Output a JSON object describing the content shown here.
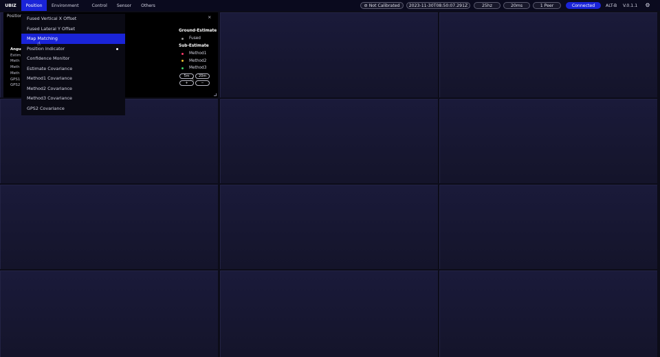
{
  "brand": "UBIZ",
  "menu": {
    "position": "Position",
    "environment": "Environment",
    "control": "Control",
    "sensor": "Sensor",
    "others": "Others"
  },
  "status": {
    "calibration": "Not Calibrated",
    "timestamp": "2023-11-30T08:50:07.291Z",
    "rate": "25hz",
    "latency": "20ms",
    "peers": "1 Peer",
    "connection": "Connected",
    "device": "ALT-B",
    "version": "V.0.1.1"
  },
  "panel": {
    "title": "Position",
    "close": "×",
    "left_labels": [
      "Angul",
      "Estim",
      "Meth",
      "Meth",
      "Meth",
      "GPS1",
      "GPS2"
    ]
  },
  "legend": {
    "ground_title": "Ground-Estimate",
    "ground_items": [
      "Fused"
    ],
    "sub_title": "Sub-Estimate",
    "sub_items": [
      "Method1",
      "Method2",
      "Method3"
    ],
    "colors": {
      "fused": "#9a9a9a",
      "method1": "#ff3b6b",
      "method2": "#f2c230",
      "method3": "#40d36a"
    }
  },
  "range_buttons": {
    "b5m": "5m",
    "b20m": "20m",
    "plus": "+",
    "minus": "−"
  },
  "dropdown": {
    "items": [
      "Fused Vertical X Offset",
      "Fused Lateral Y Offset",
      "Map Matching",
      "Position Indicator",
      "Confidence Monitor",
      "Estimate Covariance",
      "Method1 Covariance",
      "Method2 Covariance",
      "Method3 Covariance",
      "GPS2 Covariance"
    ],
    "selected_index": 2
  },
  "icons": {
    "calibration": "block-icon",
    "settings": "gear-icon",
    "cursor": "hand-pointer-icon"
  }
}
